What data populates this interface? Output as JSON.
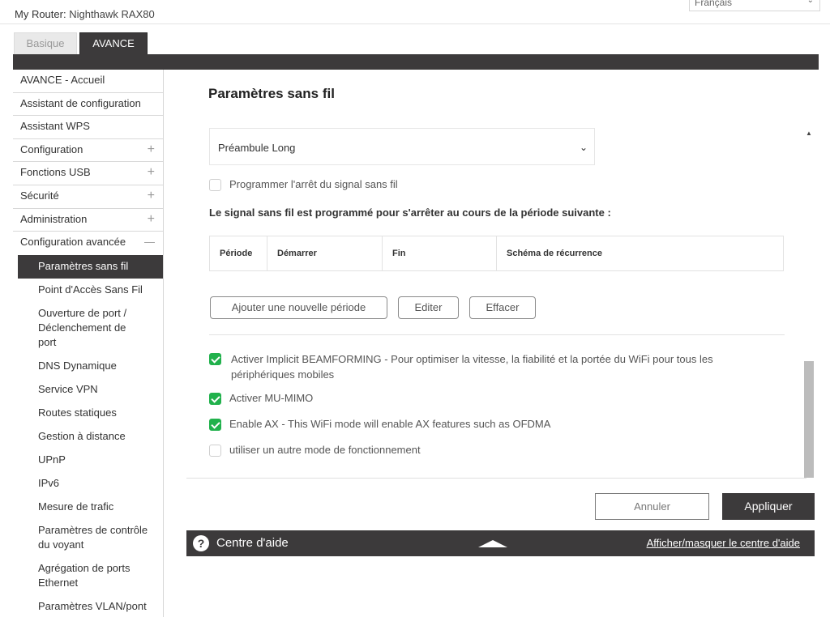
{
  "header": {
    "router_label": "My Router:",
    "router_name": "Nighthawk RAX80",
    "language": "Français"
  },
  "tabs": {
    "basic": "Basique",
    "advanced": "AVANCE"
  },
  "sidebar": {
    "items": [
      {
        "label": "AVANCE - Accueil",
        "expand": ""
      },
      {
        "label": "Assistant de configuration",
        "expand": ""
      },
      {
        "label": "Assistant WPS",
        "expand": ""
      },
      {
        "label": "Configuration",
        "expand": "+"
      },
      {
        "label": "Fonctions USB",
        "expand": "+"
      },
      {
        "label": "Sécurité",
        "expand": "+"
      },
      {
        "label": "Administration",
        "expand": "+"
      },
      {
        "label": "Configuration avancée",
        "expand": "—"
      }
    ],
    "sub_items": [
      "Paramètres sans fil",
      "Point d'Accès Sans Fil",
      "Ouverture de port / Déclenchement de port",
      "DNS Dynamique",
      "Service VPN",
      "Routes statiques",
      "Gestion à distance",
      "UPnP",
      "IPv6",
      "Mesure de trafic",
      "Paramètres de contrôle du voyant",
      "Agrégation de ports Ethernet",
      "Paramètres VLAN/pont"
    ]
  },
  "main": {
    "title": "Paramètres sans fil",
    "preamble_select": "Préambule Long",
    "schedule_checkbox": "Programmer l'arrêt du signal sans fil",
    "schedule_title": "Le signal sans fil est programmé pour s'arrêter au cours de la période suivante :",
    "table_headers": [
      "Période",
      "Démarrer",
      "Fin",
      "Schéma de récurrence"
    ],
    "buttons": {
      "add": "Ajouter une nouvelle période",
      "edit": "Editer",
      "delete": "Effacer"
    },
    "options": [
      {
        "label": "Activer Implicit BEAMFORMING - Pour optimiser la vitesse, la fiabilité et la portée du WiFi pour tous les périphériques mobiles",
        "checked": true
      },
      {
        "label": "Activer MU-MIMO",
        "checked": true
      },
      {
        "label": "Enable AX - This WiFi mode will enable AX features such as OFDMA",
        "checked": true
      },
      {
        "label": "utiliser un autre mode de fonctionnement",
        "checked": false
      }
    ]
  },
  "actions": {
    "cancel": "Annuler",
    "apply": "Appliquer"
  },
  "help": {
    "icon_glyph": "?",
    "title": "Centre d'aide",
    "toggle": "Afficher/masquer le centre d'aide"
  },
  "colors": {
    "dark": "#3c3a3b",
    "check_green": "#21b14c"
  }
}
